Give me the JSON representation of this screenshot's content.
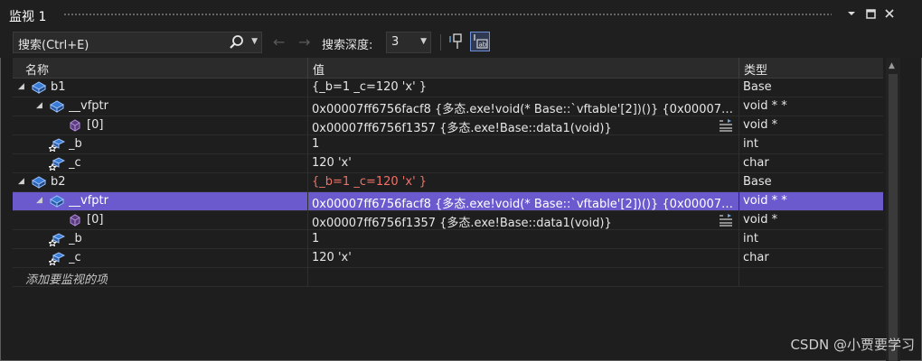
{
  "window": {
    "title": "监视 1"
  },
  "toolbar": {
    "search_placeholder": "搜索(Ctrl+E)",
    "depth_label": "搜索深度:",
    "depth_value": "3"
  },
  "columns": {
    "name": "名称",
    "value": "值",
    "type": "类型"
  },
  "rows": [
    {
      "indent": 0,
      "expander": "◢",
      "icon": "object-icon",
      "name": "b1",
      "value": "{_b=1 _c=120 'x' }",
      "type": "Base",
      "changed": false,
      "selected": false,
      "viz": false
    },
    {
      "indent": 1,
      "expander": "◢",
      "icon": "pointer-icon",
      "name": "__vfptr",
      "value": "0x00007ff6756facf8 {多态.exe!void(* Base::`vftable'[2])()} {0x00007ff67...",
      "type": "void * *",
      "changed": false,
      "selected": false,
      "viz": false
    },
    {
      "indent": 2,
      "expander": "",
      "icon": "member-icon",
      "name": "[0]",
      "value": "0x00007ff6756f1357 {多态.exe!Base::data1(void)}",
      "type": "void *",
      "changed": false,
      "selected": false,
      "viz": true
    },
    {
      "indent": 1,
      "expander": "",
      "icon": "field-icon",
      "name": "_b",
      "value": "1",
      "type": "int",
      "changed": false,
      "selected": false,
      "viz": false
    },
    {
      "indent": 1,
      "expander": "",
      "icon": "field-icon",
      "name": "_c",
      "value": "120 'x'",
      "type": "char",
      "changed": false,
      "selected": false,
      "viz": false
    },
    {
      "indent": 0,
      "expander": "◢",
      "icon": "object-icon",
      "name": "b2",
      "value": "{_b=1 _c=120 'x' }",
      "type": "Base",
      "changed": true,
      "selected": false,
      "viz": false
    },
    {
      "indent": 1,
      "expander": "◢",
      "icon": "pointer-icon",
      "name": "__vfptr",
      "value": "0x00007ff6756facf8 {多态.exe!void(* Base::`vftable'[2])()} {0x00007ff67...",
      "type": "void * *",
      "changed": false,
      "selected": true,
      "viz": false
    },
    {
      "indent": 2,
      "expander": "",
      "icon": "member-icon",
      "name": "[0]",
      "value": "0x00007ff6756f1357 {多态.exe!Base::data1(void)}",
      "type": "void *",
      "changed": false,
      "selected": false,
      "viz": true
    },
    {
      "indent": 1,
      "expander": "",
      "icon": "field-icon",
      "name": "_b",
      "value": "1",
      "type": "int",
      "changed": false,
      "selected": false,
      "viz": false
    },
    {
      "indent": 1,
      "expander": "",
      "icon": "field-icon",
      "name": "_c",
      "value": "120 'x'",
      "type": "char",
      "changed": false,
      "selected": false,
      "viz": false
    }
  ],
  "add_item_placeholder": "添加要监视的项",
  "watermark": "CSDN @小贾要学习",
  "colors": {
    "selected_row": "#6a5acd",
    "changed_value": "#f07167",
    "background": "#1e1e1e"
  }
}
